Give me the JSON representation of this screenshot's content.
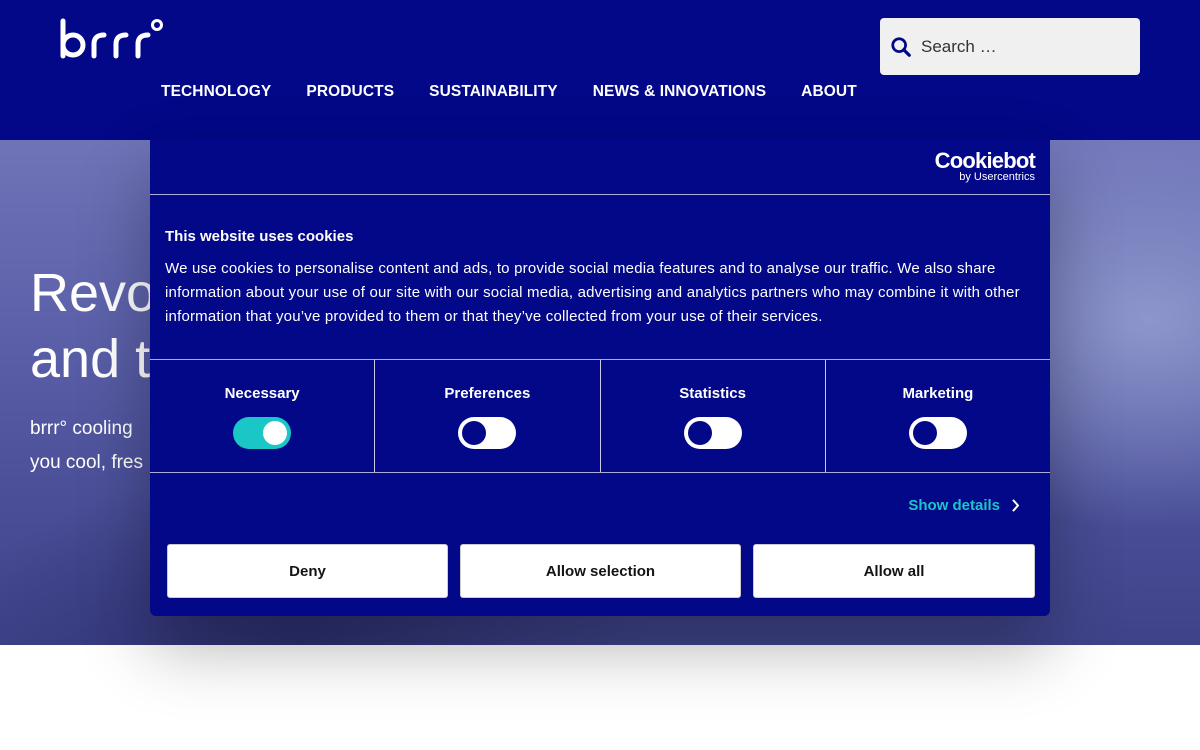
{
  "header": {
    "logo_alt": "brrr°",
    "search": {
      "placeholder": "Search …"
    },
    "nav": [
      "TECHNOLOGY",
      "PRODUCTS",
      "SUSTAINABILITY",
      "NEWS & INNOVATIONS",
      "ABOUT"
    ]
  },
  "hero": {
    "title_line1": "Revo",
    "title_line2": "and t",
    "text_line1": "brrr° cooling",
    "text_line2": "you cool, fres"
  },
  "cookie_dialog": {
    "brand": "Cookiebot",
    "brand_sub": "by Usercentrics",
    "title": "This website uses cookies",
    "body": "We use cookies to personalise content and ads, to provide social media features and to analyse our traffic. We also share information about your use of our site with our social media, advertising and analytics partners who may combine it with other information that you’ve provided to them or that they’ve collected from your use of their services.",
    "categories": [
      {
        "label": "Necessary",
        "enabled": true
      },
      {
        "label": "Preferences",
        "enabled": false
      },
      {
        "label": "Statistics",
        "enabled": false
      },
      {
        "label": "Marketing",
        "enabled": false
      }
    ],
    "show_details": "Show details",
    "buttons": {
      "deny": "Deny",
      "allow_selection": "Allow selection",
      "allow_all": "Allow all"
    }
  },
  "colors": {
    "navy": "#020887",
    "teal": "#1bc6c6",
    "white": "#ffffff"
  },
  "icons": {
    "search": "search-icon",
    "chevron": "chevron-right-icon"
  }
}
